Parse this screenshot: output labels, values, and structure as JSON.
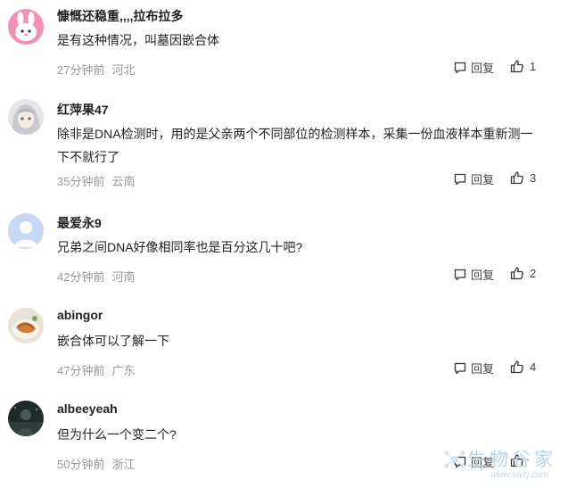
{
  "comments": [
    {
      "username": "慷慨还稳重,,,,拉布拉多",
      "content": "是有这种情况，叫墓因嵌合体",
      "time": "27分钟前",
      "location": "河北",
      "reply_label": "回复",
      "likes": "1",
      "avatar_icon": "pink-bunny-avatar"
    },
    {
      "username": "红萍果47",
      "content": "除非是DNA检测时，用的是父亲两个不同部位的检测样本，采集一份血液样本重新测一下不就行了",
      "time": "35分钟前",
      "location": "云南",
      "reply_label": "回复",
      "likes": "3",
      "avatar_icon": "anime-character-avatar"
    },
    {
      "username": "最爱永9",
      "content": "兄弟之间DNA好像相同率也是百分这几十吧?",
      "time": "42分钟前",
      "location": "河南",
      "reply_label": "回复",
      "likes": "2",
      "avatar_icon": "default-user-avatar"
    },
    {
      "username": "abingor",
      "content": "嵌合体可以了解一下",
      "time": "47分钟前",
      "location": "广东",
      "reply_label": "回复",
      "likes": "4",
      "avatar_icon": "food-photo-avatar"
    },
    {
      "username": "albeeyeah",
      "content": "但为什么一个变二个?",
      "time": "50分钟前",
      "location": "浙江",
      "reply_label": "回复",
      "likes": "",
      "avatar_icon": "dark-photo-avatar"
    }
  ],
  "watermark": {
    "text": "生物谷家",
    "url": "www.swzj.com"
  },
  "colors": {
    "meta_text": "#999999",
    "body_text": "#222222",
    "icon": "#333333"
  }
}
